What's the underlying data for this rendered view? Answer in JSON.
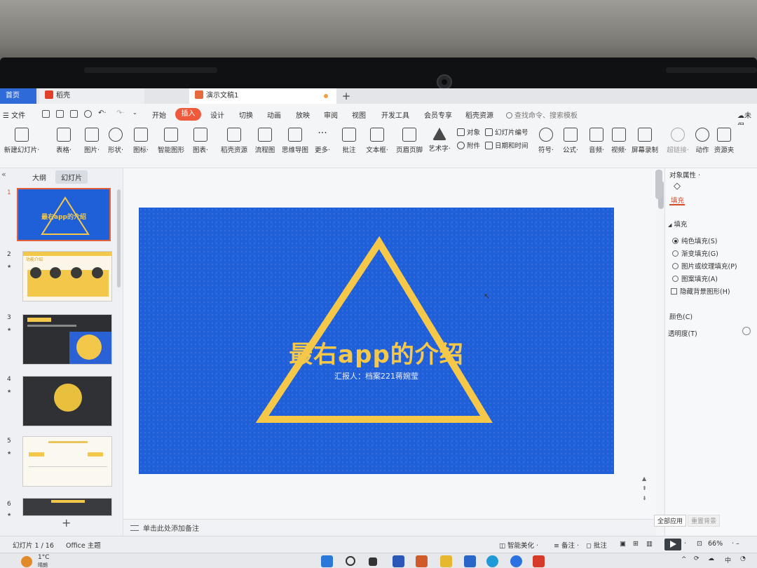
{
  "tabs": {
    "home": "首页",
    "daoke": "稻壳",
    "doc": "演示文稿1",
    "new_tab": "+"
  },
  "menu": {
    "file": "文件",
    "items": [
      "开始",
      "插入",
      "设计",
      "切换",
      "动画",
      "放映",
      "审阅",
      "视图",
      "开发工具",
      "会员专享",
      "稻壳资源"
    ],
    "active": "插入",
    "search": "查找命令、搜索模板",
    "cloud": "未保"
  },
  "ribbon": {
    "new_slide": "新建幻灯片",
    "table": "表格",
    "image": "图片",
    "shape": "形状",
    "icon": "图标",
    "smart_graphic": "智能图形",
    "chart": "图表",
    "daoke_res": "稻壳资源",
    "flowchart": "流程图",
    "mindmap": "思维导图",
    "more": "更多",
    "comment": "批注",
    "textbox": "文本框",
    "header_footer": "页眉页脚",
    "wordart": "艺术字",
    "object": "对象",
    "attachment": "附件",
    "slide_number": "幻灯片编号",
    "datetime": "日期和时间",
    "symbol": "符号",
    "formula": "公式",
    "audio": "音频",
    "video": "视频",
    "screen_record": "屏幕录制",
    "hyperlink": "超链接",
    "action": "动作",
    "resource": "资源夹"
  },
  "left_panel": {
    "tab_outline": "大纲",
    "tab_slides": "幻灯片",
    "thumbs": [
      {
        "num": "1",
        "title": "最右app的介绍"
      },
      {
        "num": "2",
        "title": "功能介绍"
      },
      {
        "num": "3",
        "title": ""
      },
      {
        "num": "4",
        "title": ""
      },
      {
        "num": "5",
        "title": ""
      },
      {
        "num": "6",
        "title": ""
      }
    ],
    "add": "+"
  },
  "slide": {
    "title": "最右app的介绍",
    "subtitle": "汇报人：档案221蒋婉莹",
    "bg_color": "#1f5fd8",
    "accent_color": "#f5c84a"
  },
  "notes": {
    "placeholder": "单击此处添加备注"
  },
  "right_panel": {
    "header": "对象属性",
    "fill_tab": "填充",
    "section": "填充",
    "options": [
      "纯色填充(S)",
      "渐变填充(G)",
      "图片或纹理填充(P)",
      "图案填充(A)"
    ],
    "hide_bg": "隐藏背景图形(H)",
    "color": "颜色(C)",
    "transparency": "透明度(T)",
    "apply_all": "全部应用",
    "reset_bg": "重置背景"
  },
  "status": {
    "slide_count": "幻灯片 1 / 16",
    "theme": "Office 主题",
    "beautify": "智能美化",
    "notes": "备注",
    "comments": "批注",
    "zoom": "66%"
  },
  "taskbar": {
    "weather_temp": "1°C",
    "weather_desc": "晴朗",
    "ime": "中"
  }
}
